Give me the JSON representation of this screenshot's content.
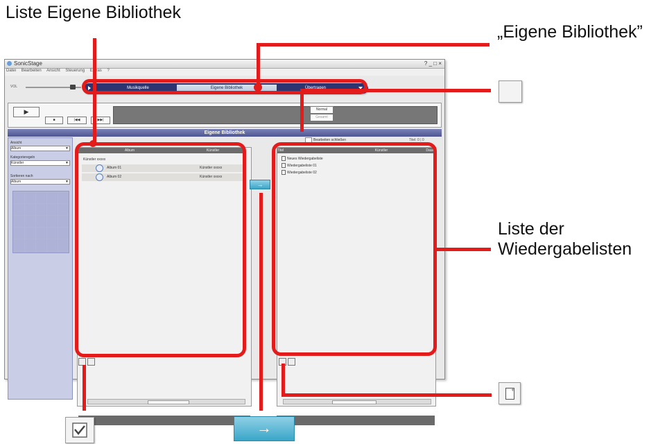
{
  "callouts": {
    "library_list": "Liste Eigene Bibliothek",
    "library_tab": "„Eigene Bibliothek”",
    "playlist_list_line1": "Liste der",
    "playlist_list_line2": "Wiedergabelisten"
  },
  "window": {
    "title": "SonicStage",
    "controls": "? _ □ ×",
    "menu": [
      "Datei",
      "Bearbeiten",
      "Ansicht",
      "Steuerung",
      "Extras",
      "?"
    ],
    "tabs": [
      "Musikquelle",
      "Eigene Bibliothek",
      "Übertragen"
    ],
    "active_tab": "Eigene Bibliothek"
  },
  "player": {
    "play": "▶",
    "stop": "■",
    "prev": "|◀◀",
    "next": "▶▶|",
    "mode": "Normal",
    "mode_sub": "Gesamt",
    "volume_label": "VOL"
  },
  "panel": {
    "header": "Eigene Bibliothek",
    "edit_checkbox_label": "Bearbeiten schließen",
    "playlist_count": "Titel: 0 | 0"
  },
  "sidebar": {
    "view_label": "Ansicht",
    "view_value": "Album",
    "sort_label": "Kategorieregeln",
    "sort_value": "Künstler",
    "filter_label": "Sortieren nach",
    "filter_value": "Album"
  },
  "library": {
    "columns": [
      "Album",
      "Künstler"
    ],
    "group": "Künstler xxxxx",
    "rows": [
      {
        "album": "Album 01",
        "artist": "Künstler xxxxx"
      },
      {
        "album": "Album 02",
        "artist": "Künstler xxxxx"
      }
    ]
  },
  "playlists": {
    "columns": [
      "Titel",
      "Künstler",
      "Dauer"
    ],
    "rows": [
      "Neues Wiedergabeliste",
      "Wiedergabeliste 01",
      "Wiedergabeliste 02"
    ]
  },
  "icons": {
    "checkbox": "checkmark-icon",
    "transfer": "right-arrow-icon",
    "new_playlist": "new-playlist-icon",
    "blank": "blank-button-icon"
  },
  "accent_red": "#e41b1b"
}
